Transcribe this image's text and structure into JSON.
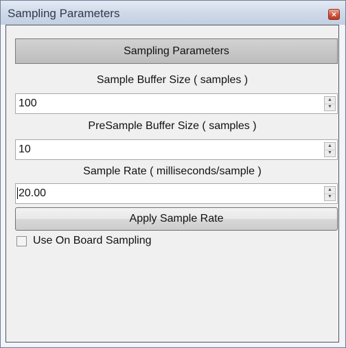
{
  "window": {
    "title": "Sampling Parameters",
    "close_glyph": "×"
  },
  "panel": {
    "header": "Sampling Parameters"
  },
  "sample_buffer": {
    "label": "Sample Buffer Size ( samples )",
    "value": "100"
  },
  "presample_buffer": {
    "label": "PreSample Buffer Size ( samples )",
    "value": "10"
  },
  "sample_rate": {
    "label": "Sample Rate ( milliseconds/sample )",
    "value": "20.00"
  },
  "apply_button": {
    "label": "Apply Sample Rate"
  },
  "onboard_sampling": {
    "label": "Use On Board Sampling",
    "checked": false
  },
  "icons": {
    "spin_up": "spin-up-arrow-icon",
    "spin_down": "spin-down-arrow-icon",
    "close": "close-icon"
  },
  "colors": {
    "titlebar": "#cfd9e8",
    "close_button": "#d0553d",
    "header_band": "#c8c8c8",
    "client_background": "#f0f0f0"
  }
}
